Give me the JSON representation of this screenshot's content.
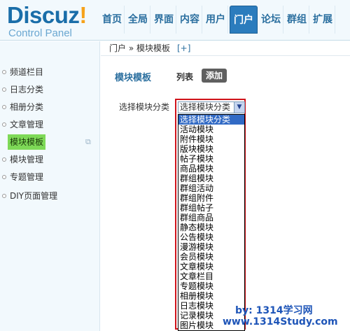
{
  "logo": {
    "main": "Discuz",
    "bang": "!",
    "sub": "Control Panel"
  },
  "topnav": [
    {
      "label": "首页"
    },
    {
      "label": "全局"
    },
    {
      "label": "界面"
    },
    {
      "label": "内容"
    },
    {
      "label": "用户"
    },
    {
      "label": "门户",
      "active": true
    },
    {
      "label": "论坛"
    },
    {
      "label": "群组"
    },
    {
      "label": "扩展"
    }
  ],
  "sidebar": [
    {
      "label": "频道栏目"
    },
    {
      "label": "日志分类"
    },
    {
      "label": "相册分类"
    },
    {
      "label": "文章管理"
    },
    {
      "label": "模块模板",
      "active": true
    },
    {
      "label": "模块管理"
    },
    {
      "label": "专题管理"
    },
    {
      "label": "DIY页面管理"
    }
  ],
  "breadcrumb": {
    "text": "门户 » 模块模板",
    "plus": "[+]"
  },
  "page": {
    "title": "模块模板",
    "tab_list": "列表",
    "tab_add": "添加",
    "field_label": "选择模块分类"
  },
  "select": {
    "value": "选择模块分类",
    "options": [
      "选择模块分类",
      "活动模块",
      "附件模块",
      "版块模块",
      "帖子模块",
      "商品模块",
      "群组模块",
      "群组活动",
      "群组附件",
      "群组帖子",
      "群组商品",
      "静态模块",
      "公告模块",
      "漫游模块",
      "会员模块",
      "文章模块",
      "文章栏目",
      "专题模块",
      "相册模块",
      "日志模块",
      "记录模块",
      "图片模块"
    ]
  },
  "watermark": {
    "line1": "by: 1314学习网",
    "line2": "www.1314Study.com"
  },
  "colors": {
    "accent": "#2b7cbd",
    "highlight": "#7ed957",
    "frame": "#d0141b",
    "selected_option": "#316ac5"
  }
}
